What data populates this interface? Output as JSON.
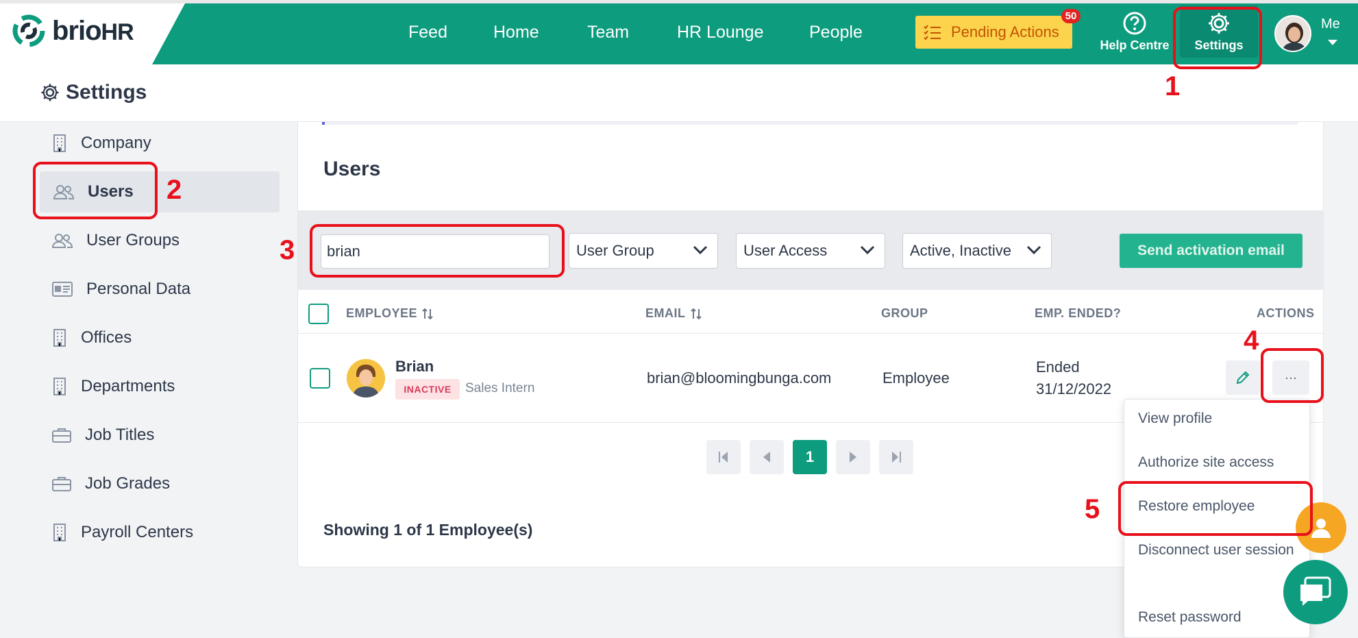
{
  "brand": {
    "logo_text": "brio",
    "logo_text_hr": "HR"
  },
  "nav": {
    "feed": "Feed",
    "home": "Home",
    "team": "Team",
    "hr_lounge": "HR Lounge",
    "people": "People",
    "pending_actions": "Pending Actions",
    "pending_count": "50",
    "help_centre": "Help Centre",
    "settings": "Settings",
    "me": "Me"
  },
  "page": {
    "title": "Settings"
  },
  "sidebar": {
    "items": [
      {
        "label": "Company",
        "icon": "building-icon"
      },
      {
        "label": "Users",
        "icon": "users-icon",
        "active": true
      },
      {
        "label": "User Groups",
        "icon": "users-icon"
      },
      {
        "label": "Personal Data",
        "icon": "id-card-icon"
      },
      {
        "label": "Offices",
        "icon": "building-icon"
      },
      {
        "label": "Departments",
        "icon": "building-icon"
      },
      {
        "label": "Job Titles",
        "icon": "briefcase-icon"
      },
      {
        "label": "Job Grades",
        "icon": "briefcase-icon"
      },
      {
        "label": "Payroll Centers",
        "icon": "building-icon"
      }
    ]
  },
  "users": {
    "heading": "Users",
    "search_value": "brian",
    "filters": {
      "user_group": "User Group",
      "user_access": "User Access",
      "status": "Active, Inactive"
    },
    "send_activation": "Send activation email",
    "columns": {
      "employee": "EMPLOYEE",
      "email": "EMAIL",
      "group": "GROUP",
      "emp_ended": "EMP. ENDED?",
      "actions": "ACTIONS"
    },
    "rows": [
      {
        "name": "Brian",
        "status": "INACTIVE",
        "title": "Sales Intern",
        "email": "brian@bloomingbunga.com",
        "group": "Employee",
        "ended_label": "Ended",
        "ended_date": "31/12/2022"
      }
    ],
    "pagination": {
      "current": "1"
    },
    "showing": "Showing 1 of 1 Employee(s)"
  },
  "actions_menu": {
    "items": [
      "View profile",
      "Authorize site access",
      "Restore employee",
      "Disconnect user session",
      "Reset password"
    ]
  },
  "annotations": {
    "step1": "1",
    "step2": "2",
    "step3": "3",
    "step4": "4",
    "step5": "5"
  },
  "colors": {
    "brand_green": "#0d9c7e",
    "annotation_red": "#e8101a",
    "pending_yellow": "#fbd34d"
  }
}
